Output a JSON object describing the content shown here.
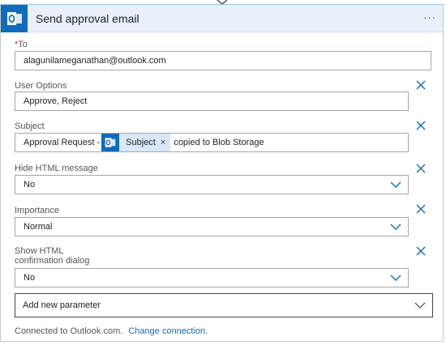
{
  "header": {
    "title": "Send approval email",
    "more_label": "···"
  },
  "fields": {
    "to": {
      "required_mark": "*",
      "label": "To",
      "value": "alagunilameganathan@outlook.com"
    },
    "user_options": {
      "label": "User Options",
      "value": "Approve, Reject"
    },
    "subject": {
      "label": "Subject",
      "prefix_text": "Approval Request -",
      "token_label": "Subject",
      "token_close": "×",
      "suffix_text": "copied to Blob Storage"
    },
    "hide_html": {
      "label": "Hide HTML message",
      "value": "No"
    },
    "importance": {
      "label": "Importance",
      "value": "Normal"
    },
    "show_html_confirm": {
      "label_line1": "Show HTML",
      "label_line2": "confirmation dialog",
      "value": "No"
    }
  },
  "add_parameter": {
    "label": "Add new parameter"
  },
  "footer": {
    "connected_text": "Connected to Outlook.com.",
    "change_link": "Change connection."
  },
  "colors": {
    "accent": "#0f6cbd",
    "header_bg": "#e8f1fa",
    "token_bg": "#d8e7f7",
    "required": "#c4314b"
  }
}
